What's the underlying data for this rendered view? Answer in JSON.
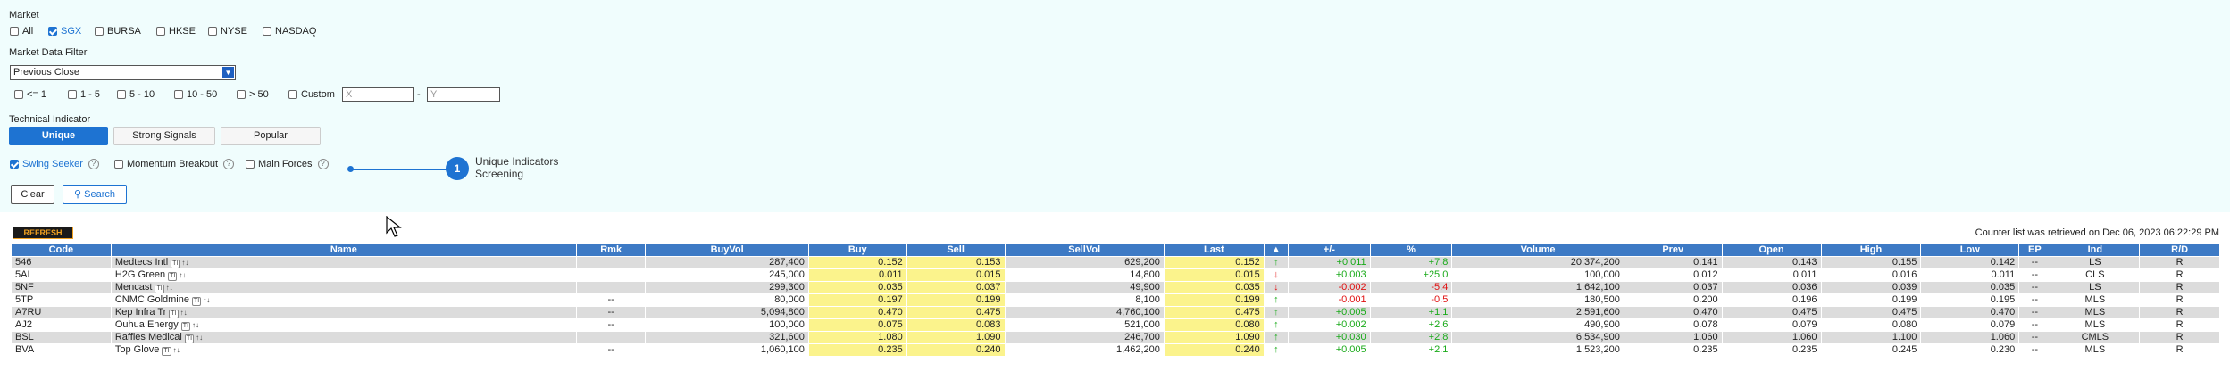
{
  "filters": {
    "market_label": "Market",
    "markets": [
      {
        "label": "All",
        "checked": false
      },
      {
        "label": "SGX",
        "checked": true
      },
      {
        "label": "BURSA",
        "checked": false
      },
      {
        "label": "HKSE",
        "checked": false
      },
      {
        "label": "NYSE",
        "checked": false
      },
      {
        "label": "NASDAQ",
        "checked": false
      }
    ],
    "market_data_label": "Market Data Filter",
    "select_value": "Previous Close",
    "ranges": [
      "<= 1",
      "1 - 5",
      "5 - 10",
      "10 - 50",
      "> 50",
      "Custom"
    ],
    "custom_x_placeholder": "X",
    "custom_sep": "-",
    "custom_y_placeholder": "Y",
    "technical_label": "Technical Indicator",
    "tabs": [
      "Unique",
      "Strong Signals",
      "Popular"
    ],
    "indicators": [
      {
        "label": "Swing Seeker",
        "checked": true
      },
      {
        "label": "Momentum Breakout",
        "checked": false
      },
      {
        "label": "Main Forces",
        "checked": false
      }
    ],
    "help_glyph": "?",
    "clear_label": "Clear",
    "search_label": "Search",
    "search_icon": "magnifier-icon"
  },
  "tooltip": {
    "badge": "1",
    "text": "Unique Indicators Screening"
  },
  "refresh_label": "REFRESH",
  "retrieved_text": "Counter list was retrieved on Dec 06, 2023 06:22:29 PM",
  "table": {
    "headers": [
      "Code",
      "Name",
      "Rmk",
      "BuyVol",
      "Buy",
      "Sell",
      "SellVol",
      "Last",
      "▲",
      "+/-",
      "%",
      "Volume",
      "Prev",
      "Open",
      "High",
      "Low",
      "EP",
      "Ind",
      "R/D"
    ],
    "ti_badge": "TI",
    "chart_glyph": "↑↓",
    "rows": [
      {
        "code": "546",
        "name": "Medtecs Intl",
        "rmk": "",
        "buyvol": "287,400",
        "buy": "0.152",
        "sell": "0.153",
        "sellvol": "629,200",
        "last": "0.152",
        "dir": "up",
        "arrow": "↑",
        "chg": "+0.011",
        "pct": "+7.8",
        "volume": "20,374,200",
        "prev": "0.141",
        "open": "0.143",
        "high": "0.155",
        "low": "0.142",
        "ep": "--",
        "ind": "LS",
        "rd": "R"
      },
      {
        "code": "5AI",
        "name": "H2G Green",
        "rmk": "",
        "buyvol": "245,000",
        "buy": "0.011",
        "sell": "0.015",
        "sellvol": "14,800",
        "last": "0.015",
        "dir": "dn",
        "arrow": "↓",
        "chg": "+0.003",
        "pct": "+25.0",
        "volume": "100,000",
        "prev": "0.012",
        "open": "0.011",
        "high": "0.016",
        "low": "0.011",
        "ep": "--",
        "ind": "CLS",
        "rd": "R"
      },
      {
        "code": "5NF",
        "name": "Mencast",
        "rmk": "",
        "buyvol": "299,300",
        "buy": "0.035",
        "sell": "0.037",
        "sellvol": "49,900",
        "last": "0.035",
        "dir": "dn",
        "arrow": "↓",
        "chg": "-0.002",
        "pct": "-5.4",
        "volume": "1,642,100",
        "prev": "0.037",
        "open": "0.036",
        "high": "0.039",
        "low": "0.035",
        "ep": "--",
        "ind": "LS",
        "rd": "R"
      },
      {
        "code": "5TP",
        "name": "CNMC Goldmine",
        "rmk": "--",
        "buyvol": "80,000",
        "buy": "0.197",
        "sell": "0.199",
        "sellvol": "8,100",
        "last": "0.199",
        "dir": "up",
        "arrow": "↑",
        "chg": "-0.001",
        "pct": "-0.5",
        "volume": "180,500",
        "prev": "0.200",
        "open": "0.196",
        "high": "0.199",
        "low": "0.195",
        "ep": "--",
        "ind": "MLS",
        "rd": "R"
      },
      {
        "code": "A7RU",
        "name": "Kep Infra Tr",
        "rmk": "--",
        "buyvol": "5,094,800",
        "buy": "0.470",
        "sell": "0.475",
        "sellvol": "4,760,100",
        "last": "0.475",
        "dir": "up",
        "arrow": "↑",
        "chg": "+0.005",
        "pct": "+1.1",
        "volume": "2,591,600",
        "prev": "0.470",
        "open": "0.475",
        "high": "0.475",
        "low": "0.470",
        "ep": "--",
        "ind": "MLS",
        "rd": "R"
      },
      {
        "code": "AJ2",
        "name": "Ouhua Energy",
        "rmk": "--",
        "buyvol": "100,000",
        "buy": "0.075",
        "sell": "0.083",
        "sellvol": "521,000",
        "last": "0.080",
        "dir": "up",
        "arrow": "↑",
        "chg": "+0.002",
        "pct": "+2.6",
        "volume": "490,900",
        "prev": "0.078",
        "open": "0.079",
        "high": "0.080",
        "low": "0.079",
        "ep": "--",
        "ind": "MLS",
        "rd": "R"
      },
      {
        "code": "BSL",
        "name": "Raffles Medical",
        "rmk": "",
        "buyvol": "321,600",
        "buy": "1.080",
        "sell": "1.090",
        "sellvol": "246,700",
        "last": "1.090",
        "dir": "up",
        "arrow": "↑",
        "chg": "+0.030",
        "pct": "+2.8",
        "volume": "6,534,900",
        "prev": "1.060",
        "open": "1.060",
        "high": "1.100",
        "low": "1.060",
        "ep": "--",
        "ind": "CMLS",
        "rd": "R"
      },
      {
        "code": "BVA",
        "name": "Top Glove",
        "rmk": "--",
        "buyvol": "1,060,100",
        "buy": "0.235",
        "sell": "0.240",
        "sellvol": "1,462,200",
        "last": "0.240",
        "dir": "up",
        "arrow": "↑",
        "chg": "+0.005",
        "pct": "+2.1",
        "volume": "1,523,200",
        "prev": "0.235",
        "open": "0.235",
        "high": "0.245",
        "low": "0.230",
        "ep": "--",
        "ind": "MLS",
        "rd": "R"
      }
    ]
  }
}
